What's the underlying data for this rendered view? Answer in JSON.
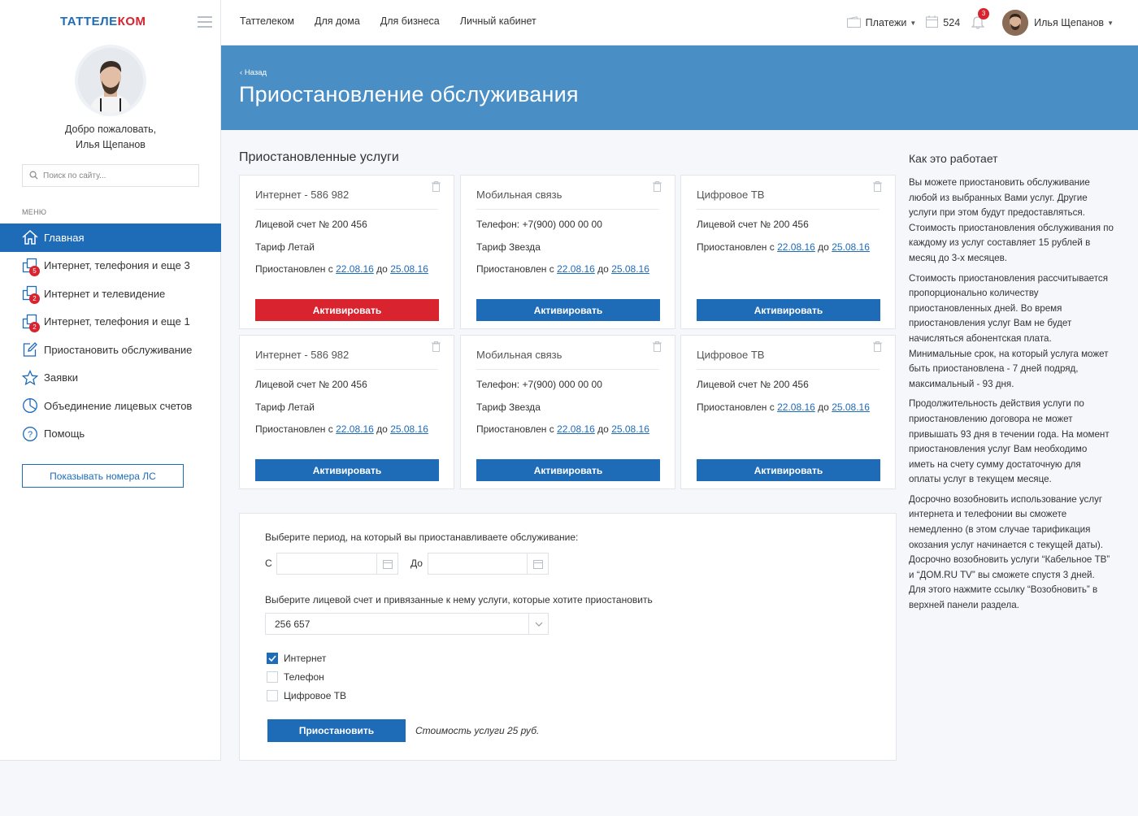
{
  "brand": {
    "logo_part1": "ТАТТЕЛЕ",
    "logo_part2": "КОМ"
  },
  "sidebar": {
    "welcome_line1": "Добро пожаловать,",
    "welcome_line2": "Илья Щепанов",
    "search_placeholder": "Поиск по сайту...",
    "menu_label": "МЕНЮ",
    "items": [
      {
        "label": "Главная",
        "icon": "home-icon"
      },
      {
        "label": "Интернет, телефония и еще 3",
        "icon": "services-icon",
        "badge": "5"
      },
      {
        "label": "Интернет и телевидение",
        "icon": "services-icon",
        "badge": "2"
      },
      {
        "label": "Интернет, телефония и еще 1",
        "icon": "services-icon",
        "badge": "2"
      },
      {
        "label": "Приостановить обслуживание",
        "icon": "edit-icon"
      },
      {
        "label": "Заявки",
        "icon": "star-icon"
      },
      {
        "label": "Объединение лицевых счетов",
        "icon": "pie-icon"
      },
      {
        "label": "Помощь",
        "icon": "help-icon"
      }
    ],
    "show_accounts_button": "Показывать номера ЛС"
  },
  "topnav": {
    "links": [
      "Таттелеком",
      "Для дома",
      "Для бизнеса",
      "Личный кабинет"
    ],
    "payments": "Платежи",
    "counter": "524",
    "notifications": "3",
    "user_name": "Илья Щепанов"
  },
  "header": {
    "back": "Назад",
    "title": "Приостановление обслуживания"
  },
  "suspended": {
    "title": "Приостановленные услуги",
    "cards": [
      {
        "title": "Интернет - 586 982",
        "row1": "Лицевой счет № 200 456",
        "row2": "Тариф Летай",
        "status": "Приостановлен с",
        "from": "22.08.16",
        "to_word": "до",
        "to": "25.08.16",
        "button": "Активировать",
        "button_color": "#d9232e"
      },
      {
        "title": "Мобильная связь",
        "row1": "Телефон: +7(900) 000 00 00",
        "row2": "Тариф Звезда",
        "status": "Приостановлен с",
        "from": "22.08.16",
        "to_word": "до",
        "to": "25.08.16",
        "button": "Активировать",
        "button_color": "#1e6bb8"
      },
      {
        "title": "Цифровое ТВ",
        "row1": "Лицевой счет № 200 456",
        "row2": "",
        "status": "Приостановлен с",
        "from": "22.08.16",
        "to_word": "до",
        "to": "25.08.16",
        "button": "Активировать",
        "button_color": "#1e6bb8"
      },
      {
        "title": "Интернет - 586 982",
        "row1": "Лицевой счет № 200 456",
        "row2": "Тариф Летай",
        "status": "Приостановлен с",
        "from": "22.08.16",
        "to_word": "до",
        "to": "25.08.16",
        "button": "Активировать",
        "button_color": "#1e6bb8"
      },
      {
        "title": "Мобильная связь",
        "row1": "Телефон: +7(900) 000 00 00",
        "row2": "Тариф Звезда",
        "status": "Приостановлен с",
        "from": "22.08.16",
        "to_word": "до",
        "to": "25.08.16",
        "button": "Активировать",
        "button_color": "#1e6bb8"
      },
      {
        "title": "Цифровое ТВ",
        "row1": "Лицевой счет № 200 456",
        "row2": "",
        "status": "Приостановлен с",
        "from": "22.08.16",
        "to_word": "до",
        "to": "25.08.16",
        "button": "Активировать",
        "button_color": "#1e6bb8"
      }
    ]
  },
  "form": {
    "period_label": "Выберите период, на который вы приостанавливаете обслуживание:",
    "from_label": "С",
    "to_label": "До",
    "from_value": "",
    "to_value": "",
    "account_label": "Выберите лицевой счет и привязанные к нему услуги, которые хотите приостановить",
    "account_value": "256 657",
    "options": [
      {
        "label": "Интернет",
        "checked": true
      },
      {
        "label": "Телефон",
        "checked": false
      },
      {
        "label": "Цифровое ТВ",
        "checked": false
      }
    ],
    "submit": "Приостановить",
    "cost": "Стоимость услуги 25 руб."
  },
  "info": {
    "title": "Как это работает",
    "paragraphs": [
      "Вы можете приостановить обслуживание любой из выбранных Вами услуг. Другие услуги при этом будут предоставляться. Стоимость приостановления обслуживания по каждому из услуг составляет 15 рублей в месяц до 3-х месяцев.",
      "Стоимость приостановления рассчитывается пропорционально количеству приостановленных дней. Во время приостановления услуг Вам не будет начисляться абонентская плата. Минимальные срок, на который услуга может быть приостановлена - 7 дней подряд, максимальный - 93 дня.",
      "Продолжительность действия услуги по приостановлению договора не может привышать 93 дня в течении года. На момент приостановления услуг Вам необходимо иметь на счету сумму достаточную для оплаты услуг в текущем месяце.",
      "Досрочно возобновить использование услуг интернета и телефонии вы сможете немедленно (в этом случае тарификация окозания услуг начинается с текущей даты). Досрочно возобновить услуги “Кабельное ТВ” и “ДОМ.RU TV” вы сможете спустя 3 дней. Для этого нажмите ссылку “Возобновить” в верхней панели раздела."
    ]
  }
}
